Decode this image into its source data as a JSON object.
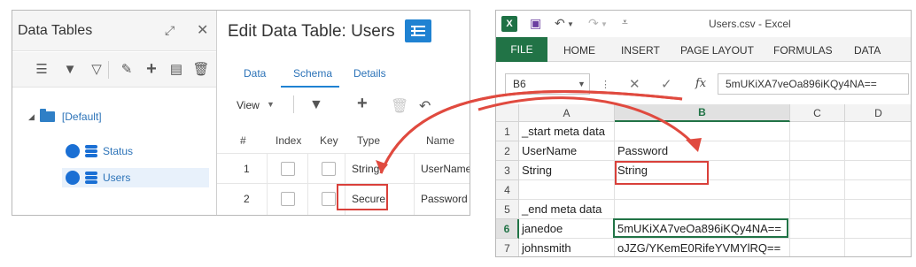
{
  "data_tables": {
    "title": "Data Tables",
    "root_label": "[Default]",
    "items": [
      {
        "label": "Status"
      },
      {
        "label": "Users"
      }
    ]
  },
  "edit_table": {
    "title": "Edit Data Table: Users",
    "tabs": [
      "Data",
      "Schema",
      "Details"
    ],
    "active_tab": "Schema",
    "view_label": "View",
    "columns": [
      "#",
      "Index",
      "Key",
      "Type",
      "Name"
    ],
    "rows": [
      {
        "num": "1",
        "type": "String",
        "name": "UserName"
      },
      {
        "num": "2",
        "type": "Secure",
        "name": "Password"
      }
    ]
  },
  "excel": {
    "app_letter": "X",
    "window_title": "Users.csv - Excel",
    "file_tab": "FILE",
    "ribbon_tabs": [
      "HOME",
      "INSERT",
      "PAGE LAYOUT",
      "FORMULAS",
      "DATA"
    ],
    "name_box": "B6",
    "fx_label": "fx",
    "formula_value": "5mUKiXA7veOa896iKQy4NA==",
    "columns": [
      "A",
      "B",
      "C",
      "D"
    ],
    "rows": [
      {
        "num": "1",
        "a": "_start meta data",
        "b": ""
      },
      {
        "num": "2",
        "a": "UserName",
        "b": "Password"
      },
      {
        "num": "3",
        "a": "String",
        "b": "String"
      },
      {
        "num": "4",
        "a": "",
        "b": ""
      },
      {
        "num": "5",
        "a": "_end meta data",
        "b": ""
      },
      {
        "num": "6",
        "a": "janedoe",
        "b": "5mUKiXA7veOa896iKQy4NA=="
      },
      {
        "num": "7",
        "a": "johnsmith",
        "b": "oJZG/YKemE0RifeYVMYlRQ=="
      }
    ],
    "selected_cell": "B6"
  },
  "colors": {
    "highlight_red": "#d9403a",
    "excel_green": "#217346",
    "accent_blue": "#1f82d2"
  }
}
